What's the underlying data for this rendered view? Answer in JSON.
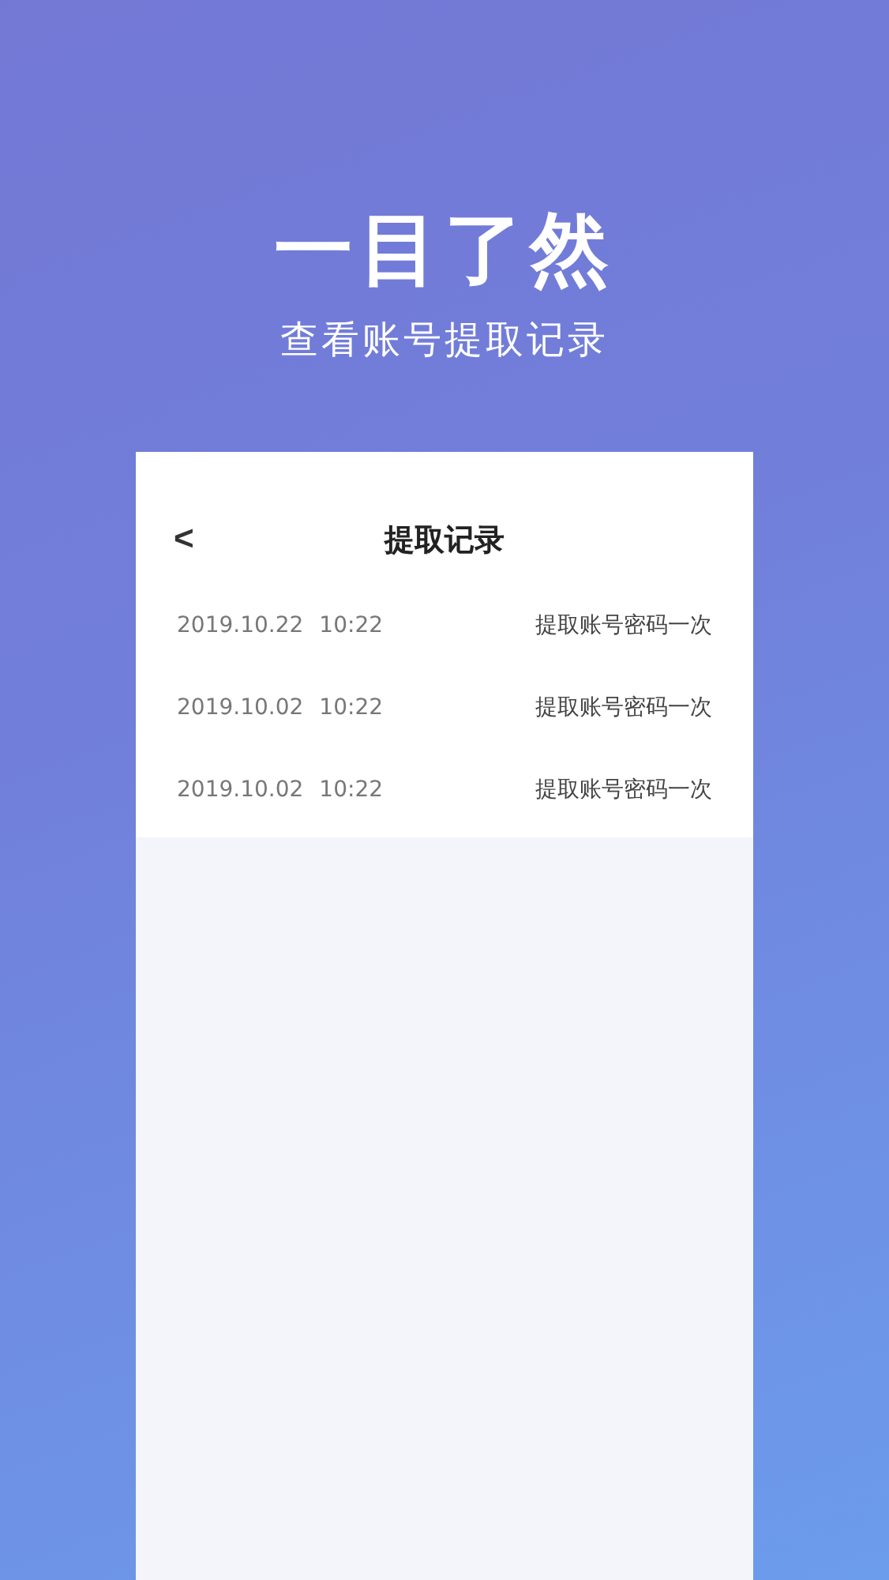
{
  "headline": "一目了然",
  "subheadline": "查看账号提取记录",
  "screen": {
    "title": "提取记录",
    "back": "<",
    "records": [
      {
        "date": "2019.10.22",
        "time": "10:22",
        "action": "提取账号密码一次"
      },
      {
        "date": "2019.10.02",
        "time": "10:22",
        "action": "提取账号密码一次"
      },
      {
        "date": "2019.10.02",
        "time": "10:22",
        "action": "提取账号密码一次"
      }
    ]
  }
}
